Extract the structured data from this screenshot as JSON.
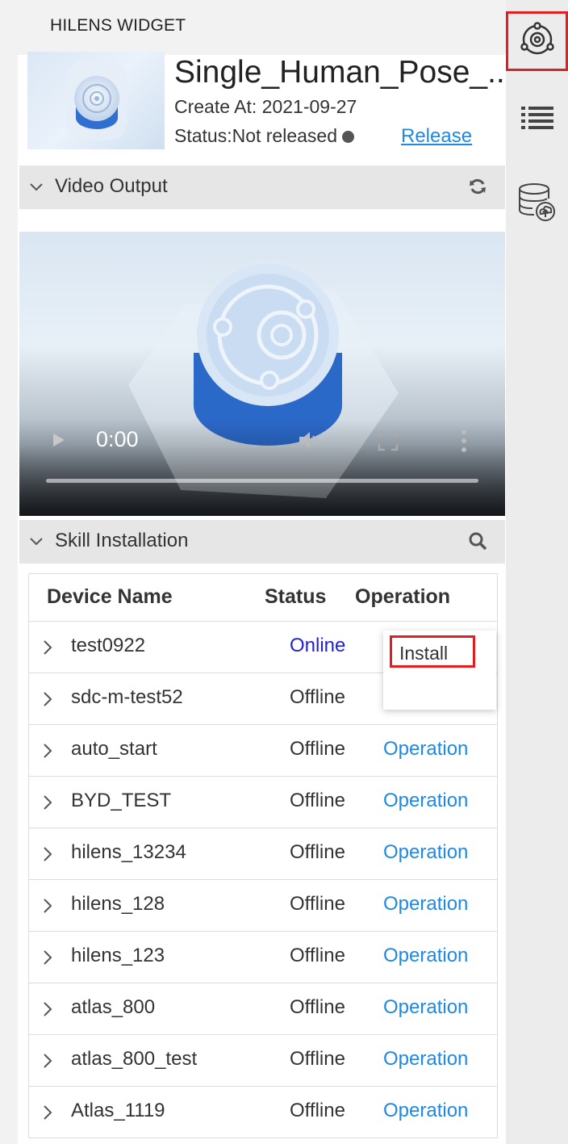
{
  "widget": {
    "title": "HILENS WIDGET"
  },
  "app": {
    "name": "Single_Human_Pose_...",
    "created": "Create At: 2021-09-27",
    "status": "Status:Not released",
    "release_label": "Release"
  },
  "video_section": {
    "label": "Video Output",
    "time": "0:00",
    "progress": 0
  },
  "skill_section": {
    "label": "Skill Installation"
  },
  "table": {
    "headers": {
      "device": "Device Name",
      "status": "Status",
      "operation": "Operation"
    },
    "rows": [
      {
        "name": "test0922",
        "status": "Online",
        "operation": ""
      },
      {
        "name": "sdc-m-test52",
        "status": "Offline",
        "operation": ""
      },
      {
        "name": "auto_start",
        "status": "Offline",
        "operation": "Operation"
      },
      {
        "name": "BYD_TEST",
        "status": "Offline",
        "operation": "Operation"
      },
      {
        "name": "hilens_13234",
        "status": "Offline",
        "operation": "Operation"
      },
      {
        "name": "hilens_128",
        "status": "Offline",
        "operation": "Operation"
      },
      {
        "name": "hilens_123",
        "status": "Offline",
        "operation": "Operation"
      },
      {
        "name": "atlas_800",
        "status": "Offline",
        "operation": "Operation"
      },
      {
        "name": "atlas_800_test",
        "status": "Offline",
        "operation": "Operation"
      },
      {
        "name": "Atlas_1119",
        "status": "Offline",
        "operation": "Operation"
      }
    ]
  },
  "popup": {
    "install_label": "Install"
  },
  "sidebar": {
    "icons": [
      "camera-icon",
      "list-icon",
      "cloud-database-icon"
    ]
  },
  "colors": {
    "link": "#1e88e5",
    "online": "#2121d8",
    "highlight": "#e02020"
  }
}
